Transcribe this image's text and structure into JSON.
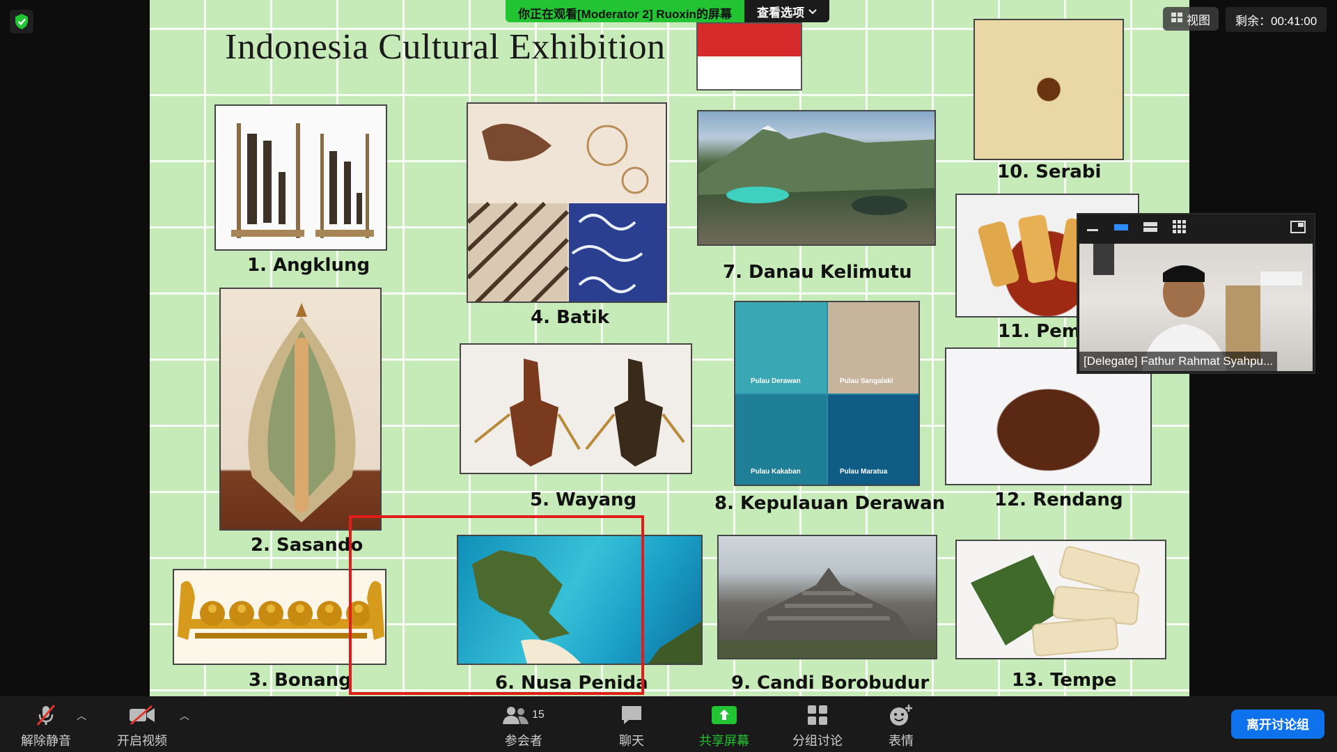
{
  "slide": {
    "title": "Indonesia Cultural Exhibition",
    "items": [
      {
        "caption": "1. Angklung"
      },
      {
        "caption": "4. Batik"
      },
      {
        "caption": "7. Danau Kelimutu"
      },
      {
        "caption": "10. Serabi"
      },
      {
        "caption": "11. Pem"
      },
      {
        "caption": "2. Sasando"
      },
      {
        "caption": "5. Wayang"
      },
      {
        "caption": "8. Kepulauan Derawan"
      },
      {
        "caption": "12. Rendang"
      },
      {
        "caption": "3. Bonang"
      },
      {
        "caption": "6. Nusa Penida"
      },
      {
        "caption": "9. Candi Borobudur"
      },
      {
        "caption": "13. Tempe"
      }
    ],
    "derawan_labels": [
      "Pulau Derawan",
      "Pulau Sangalaki",
      "Pulau Kakaban",
      "Pulau Maratua"
    ]
  },
  "share_banner": {
    "text": "你正在观看[Moderator 2] Ruoxin的屏幕",
    "options_label": "查看选项"
  },
  "top_right": {
    "view_label": "视图",
    "timer": "剩余：00:41:00"
  },
  "video_panel": {
    "name": "[Delegate] Fathur Rahmat Syahpu..."
  },
  "toolbar": {
    "unmute": "解除静音",
    "start_video": "开启视频",
    "participants": "参会者",
    "participant_count": "15",
    "chat": "聊天",
    "share_screen": "共享屏幕",
    "breakout": "分组讨论",
    "reactions": "表情",
    "leave": "离开讨论组"
  },
  "colors": {
    "share_green": "#23c433",
    "leave_blue": "#0e72ed",
    "highlight_red": "#e21b1b"
  }
}
